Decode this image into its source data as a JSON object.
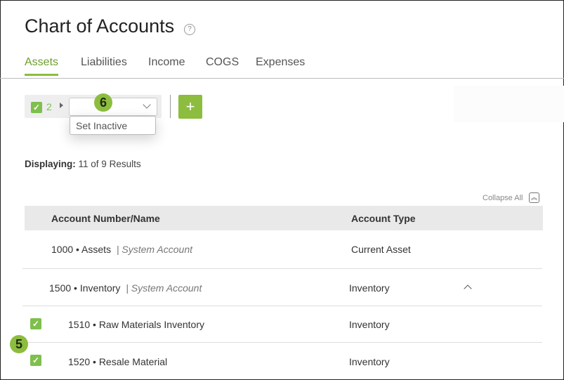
{
  "page": {
    "title": "Chart of Accounts",
    "help_icon": "?"
  },
  "tabs": [
    {
      "label": "Assets",
      "active": true
    },
    {
      "label": "Liabilities",
      "active": false
    },
    {
      "label": "Income",
      "active": false
    },
    {
      "label": "COGS",
      "active": false
    },
    {
      "label": "Expenses",
      "active": false
    }
  ],
  "toolbar": {
    "selected_count": "2",
    "action_select_value": "",
    "dropdown_option": "Set Inactive",
    "add_label": "+",
    "step_badge": "6"
  },
  "results": {
    "label": "Displaying:",
    "text": "11 of 9 Results"
  },
  "table": {
    "collapse_all": "Collapse All",
    "columns": [
      "Account Number/Name",
      "Account Type"
    ],
    "rows": [
      {
        "name": "1000 • Assets",
        "tag": "| System Account",
        "type": "Current Asset",
        "checked": false
      },
      {
        "name": "1500 • Inventory",
        "tag": "| System Account",
        "type": "Inventory",
        "checked": false,
        "expanded": true
      },
      {
        "name": "1510 • Raw Materials Inventory",
        "tag": "",
        "type": "Inventory",
        "checked": true
      },
      {
        "name": "1520 • Resale Material",
        "tag": "",
        "type": "Inventory",
        "checked": true
      }
    ],
    "step_badge": "5"
  },
  "colors": {
    "accent": "#8cbd3f",
    "accent_dark": "#6e9e2c",
    "checkbox": "#7fbf4d"
  }
}
